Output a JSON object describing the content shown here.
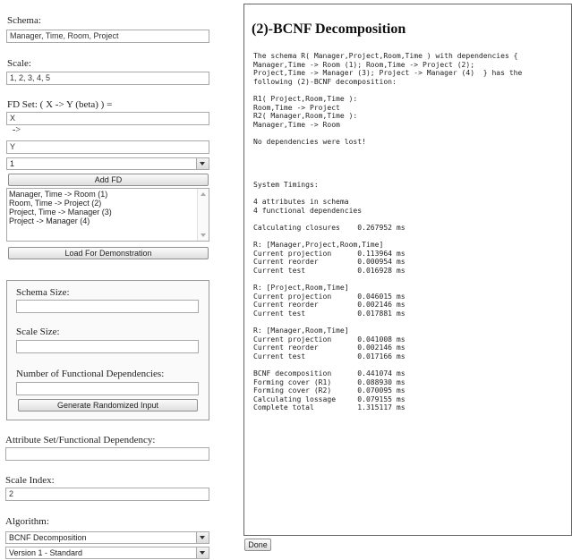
{
  "form": {
    "schema_label": "Schema:",
    "schema_value": "Manager, Time, Room, Project",
    "scale_label": "Scale:",
    "scale_value": "1, 2, 3, 4, 5",
    "fd_set_label": "FD Set: ( X -> Y (beta) ) =",
    "fd_x_value": "X",
    "arrow_text": "->",
    "fd_y_value": "Y",
    "beta_selected": "1",
    "add_fd_label": "Add FD",
    "fd_list": [
      "Manager, Time -> Room (1)",
      "Room, Time -> Project (2)",
      "Project, Time -> Manager (3)",
      "Project -> Manager (4)"
    ],
    "load_demo_label": "Load For Demonstration"
  },
  "random": {
    "schema_size_label": "Schema Size:",
    "scale_size_label": "Scale Size:",
    "num_fd_label": "Number of Functional Dependencies:",
    "generate_label": "Generate Randomized Input"
  },
  "lower": {
    "attr_fd_label": "Attribute Set/Functional Dependency:",
    "attr_fd_value": "",
    "scale_index_label": "Scale Index:",
    "scale_index_value": "2",
    "algorithm_label": "Algorithm:",
    "algorithm_selected": "BCNF Decomposition",
    "version_selected": "Version 1 - Standard"
  },
  "output": {
    "title": "(2)-BCNF Decomposition",
    "lines": [
      "The schema R( Manager,Project,Room,Time ) with dependencies {",
      "Manager,Time -> Room (1); Room,Time -> Project (2);",
      "Project,Time -> Manager (3); Project -> Manager (4)  } has the",
      "following (2)-BCNF decomposition:",
      "",
      "R1( Project,Room,Time ):",
      "Room,Time -> Project",
      "R2( Manager,Room,Time ):",
      "Manager,Time -> Room",
      "",
      "No dependencies were lost!",
      "",
      "",
      "",
      "",
      "System Timings:",
      "",
      "4 attributes in schema",
      "4 functional dependencies",
      "",
      "Calculating closures    0.267952 ms",
      "",
      "R: [Manager,Project,Room,Time]",
      "Current projection      0.113964 ms",
      "Current reorder         0.000954 ms",
      "Current test            0.016928 ms",
      "",
      "R: [Project,Room,Time]",
      "Current projection      0.046015 ms",
      "Current reorder         0.002146 ms",
      "Current test            0.017881 ms",
      "",
      "R: [Manager,Room,Time]",
      "Current projection      0.041008 ms",
      "Current reorder         0.002146 ms",
      "Current test            0.017166 ms",
      "",
      "BCNF decomposition      0.441074 ms",
      "Forming cover (R1)      0.088930 ms",
      "Forming cover (R2)      0.070095 ms",
      "Calculating lossage     0.079155 ms",
      "Complete total          1.315117 ms"
    ]
  },
  "done_label": "Done"
}
